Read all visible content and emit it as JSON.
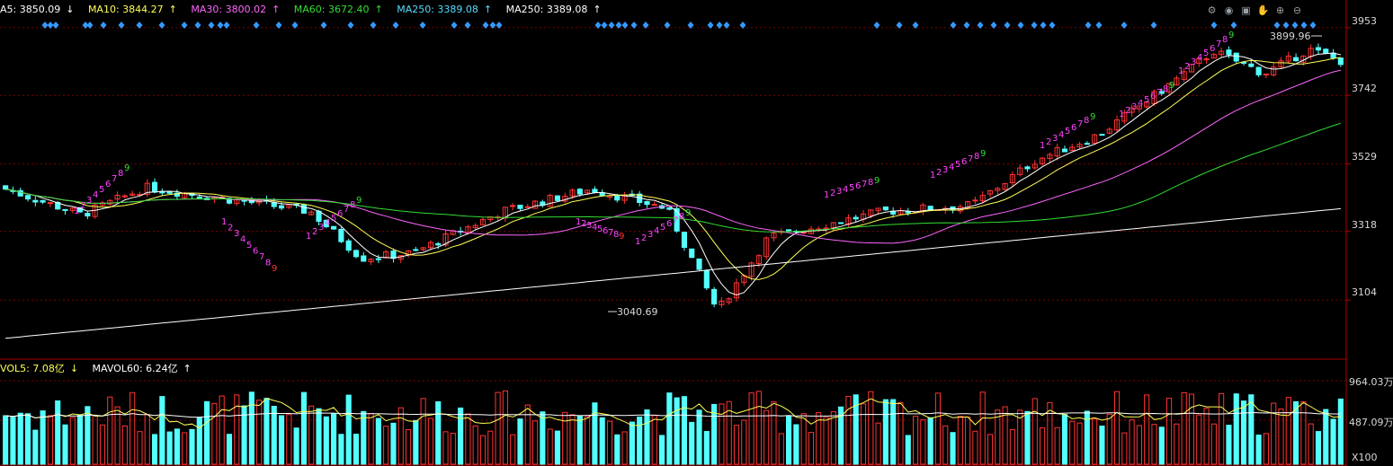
{
  "price_legend": {
    "ma5": {
      "label": "A5: 3850.09",
      "arrow": "↓",
      "color": "#ffffff"
    },
    "ma10": {
      "label": "MA10: 3844.27",
      "arrow": "↑",
      "color": "#ffff55"
    },
    "ma30": {
      "label": "MA30: 3800.02",
      "arrow": "↑",
      "color": "#ff66ff"
    },
    "ma60": {
      "label": "MA60: 3672.40",
      "arrow": "↑",
      "color": "#33dd33"
    },
    "ma250a": {
      "label": "MA250: 3389.08",
      "arrow": "↑",
      "color": "#55ddff"
    },
    "ma250b": {
      "label": "MA250: 3389.08",
      "arrow": "↑",
      "color": "#ffffff"
    }
  },
  "volume_legend": {
    "vol5": {
      "label": "VOL5: 7.08亿",
      "arrow": "↓",
      "color": "#ffff55"
    },
    "mavol60": {
      "label": "MAVOL60: 6.24亿",
      "arrow": "↑",
      "color": "#ffffff"
    }
  },
  "toolbar": {
    "icons": [
      "settings-icon",
      "eye-icon",
      "print-icon",
      "hand-icon",
      "zoom-in-icon",
      "zoom-out-icon"
    ],
    "glyphs": [
      "⚙",
      "◉",
      "▣",
      "✋",
      "⊕",
      "⊖"
    ]
  },
  "y_axis": {
    "ticks": [
      "3953",
      "3742",
      "3529",
      "3318",
      "3104"
    ]
  },
  "vol_axis": {
    "ticks": [
      "964.03万",
      "487.09万"
    ],
    "unit": "X100"
  },
  "annotations": {
    "high_label": "3899.96",
    "low_label": "3040.69"
  },
  "colors": {
    "up": "#ff3333",
    "down": "#54ffff",
    "grid": "#7a0000",
    "axis_border": "#aa0000",
    "signal_up": "#ff44ff",
    "signal_up_9": "#33dd33",
    "signal_down": "#ff44ff",
    "signal_down_9": "#ff3333",
    "diamond": "#3399ff"
  },
  "chart_data": {
    "type": "candlestick",
    "ylim": [
      2920,
      4000
    ],
    "yticks": [
      3953,
      3742,
      3529,
      3318,
      3104
    ],
    "volume_ticks": [
      964.03,
      487.09
    ],
    "volume_unit": "万",
    "anchor_prices": {
      "first_close": 3450,
      "mid_low": 3040.69,
      "recent_high": 3899.96,
      "last_close": 3850.09
    },
    "ma_last": {
      "MA5": 3850.09,
      "MA10": 3844.27,
      "MA30": 3800.02,
      "MA60": 3672.4,
      "MA250": 3389.08
    },
    "series_count": 180
  }
}
